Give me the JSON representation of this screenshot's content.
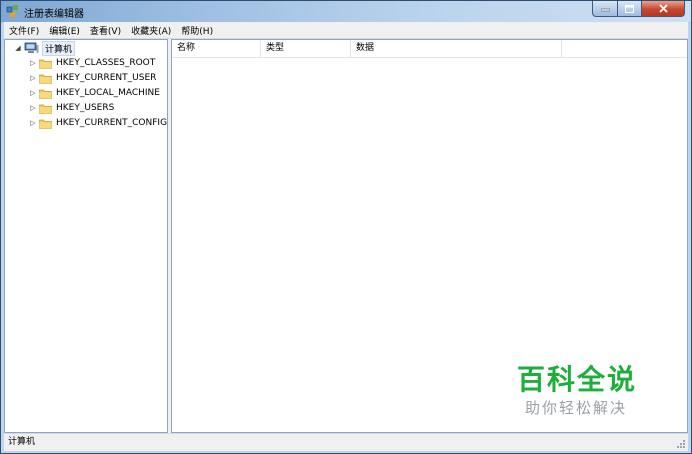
{
  "window": {
    "title": "注册表编辑器"
  },
  "menubar": [
    "文件(F)",
    "编辑(E)",
    "查看(V)",
    "收藏夹(A)",
    "帮助(H)"
  ],
  "tree": {
    "root": {
      "label": "计算机",
      "expanded": true
    },
    "keys": [
      {
        "label": "HKEY_CLASSES_ROOT"
      },
      {
        "label": "HKEY_CURRENT_USER"
      },
      {
        "label": "HKEY_LOCAL_MACHINE"
      },
      {
        "label": "HKEY_USERS"
      },
      {
        "label": "HKEY_CURRENT_CONFIG"
      }
    ]
  },
  "list": {
    "columns": [
      "名称",
      "类型",
      "数据"
    ]
  },
  "statusbar": {
    "path": "计算机"
  },
  "watermark": {
    "title": "百科全说",
    "subtitle": "助你轻松解决"
  },
  "colors": {
    "title_bar": "#9fc0e3",
    "close_button": "#c8472f",
    "watermark_green": "#1dae3c"
  }
}
